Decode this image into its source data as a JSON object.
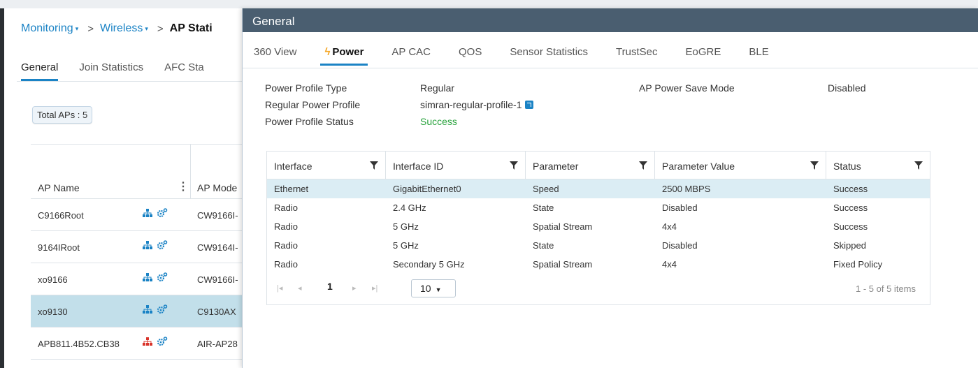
{
  "breadcrumb": {
    "items": [
      "Monitoring",
      "Wireless",
      "AP Stati"
    ],
    "separator": ">",
    "caret": "▾"
  },
  "background_tabs": [
    "General",
    "Join Statistics",
    "AFC Sta"
  ],
  "total_aps": "Total APs : 5",
  "ap_table": {
    "headers": {
      "name": "AP Name",
      "mode": "AP Mode"
    },
    "rows": [
      {
        "name": "C9166Root",
        "mode": "CW9166I-",
        "topology_icon_color": "#1b83c5"
      },
      {
        "name": "9164IRoot",
        "mode": "CW9164I-",
        "topology_icon_color": "#1b83c5"
      },
      {
        "name": "xo9166",
        "mode": "CW9166I-",
        "topology_icon_color": "#1b83c5"
      },
      {
        "name": "xo9130",
        "mode": "C9130AX",
        "topology_icon_color": "#1b83c5",
        "selected": true
      },
      {
        "name": "APB811.4B52.CB38",
        "mode": "AIR-AP28",
        "topology_icon_color": "#d9342b"
      }
    ]
  },
  "modal": {
    "title": "General",
    "tabs": [
      "360 View",
      "Power",
      "AP CAC",
      "QOS",
      "Sensor Statistics",
      "TrustSec",
      "EoGRE",
      "BLE"
    ],
    "active_tab": "Power",
    "active_tab_icon": "ϟ",
    "info": {
      "power_profile_type_label": "Power Profile Type",
      "power_profile_type": "Regular",
      "regular_power_profile_label": "Regular Power Profile",
      "regular_power_profile": "simran-regular-profile-1",
      "power_profile_status_label": "Power Profile Status",
      "power_profile_status": "Success",
      "ap_power_save_mode_label": "AP Power Save Mode",
      "ap_power_save_mode": "Disabled"
    },
    "table": {
      "headers": [
        "Interface",
        "Interface ID",
        "Parameter",
        "Parameter Value",
        "Status"
      ],
      "rows": [
        [
          "Ethernet",
          "GigabitEthernet0",
          "Speed",
          "2500 MBPS",
          "Success"
        ],
        [
          "Radio",
          "2.4 GHz",
          "State",
          "Disabled",
          "Success"
        ],
        [
          "Radio",
          "5 GHz",
          "Spatial Stream",
          "4x4",
          "Success"
        ],
        [
          "Radio",
          "5 GHz",
          "State",
          "Disabled",
          "Skipped"
        ],
        [
          "Radio",
          "Secondary 5 GHz",
          "Spatial Stream",
          "4x4",
          "Fixed Policy"
        ]
      ]
    },
    "pager": {
      "page": "1",
      "page_size": "10",
      "count": "1 - 5 of 5 items"
    }
  },
  "colors": {
    "accent": "#1b83c5",
    "header": "#4a5e70",
    "success": "#2aa33e",
    "selected_row": "#c2dfea",
    "highlight_row": "#dbedf4"
  }
}
